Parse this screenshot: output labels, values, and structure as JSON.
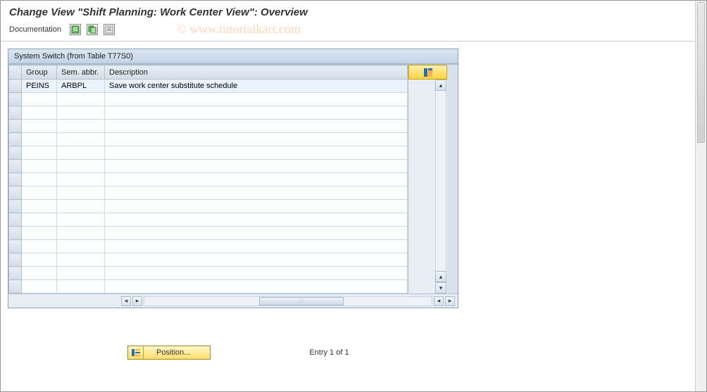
{
  "title": "Change View \"Shift Planning: Work Center View\": Overview",
  "toolbar": {
    "documentation_label": "Documentation"
  },
  "watermark": "© www.tutorialkart.com",
  "table": {
    "caption": "System Switch (from Table T77S0)",
    "columns": {
      "group": "Group",
      "abbr": "Sem. abbr.",
      "desc": "Description"
    },
    "rows": [
      {
        "group": "PEINS",
        "abbr": "ARBPL",
        "desc": "Save work center substitute schedule"
      }
    ],
    "empty_row_count": 15
  },
  "footer": {
    "position_label": "Position...",
    "entry_text": "Entry 1 of 1"
  },
  "colors": {
    "accent_yellow": "#ffe06a",
    "header_blue": "#c3d4e6"
  }
}
